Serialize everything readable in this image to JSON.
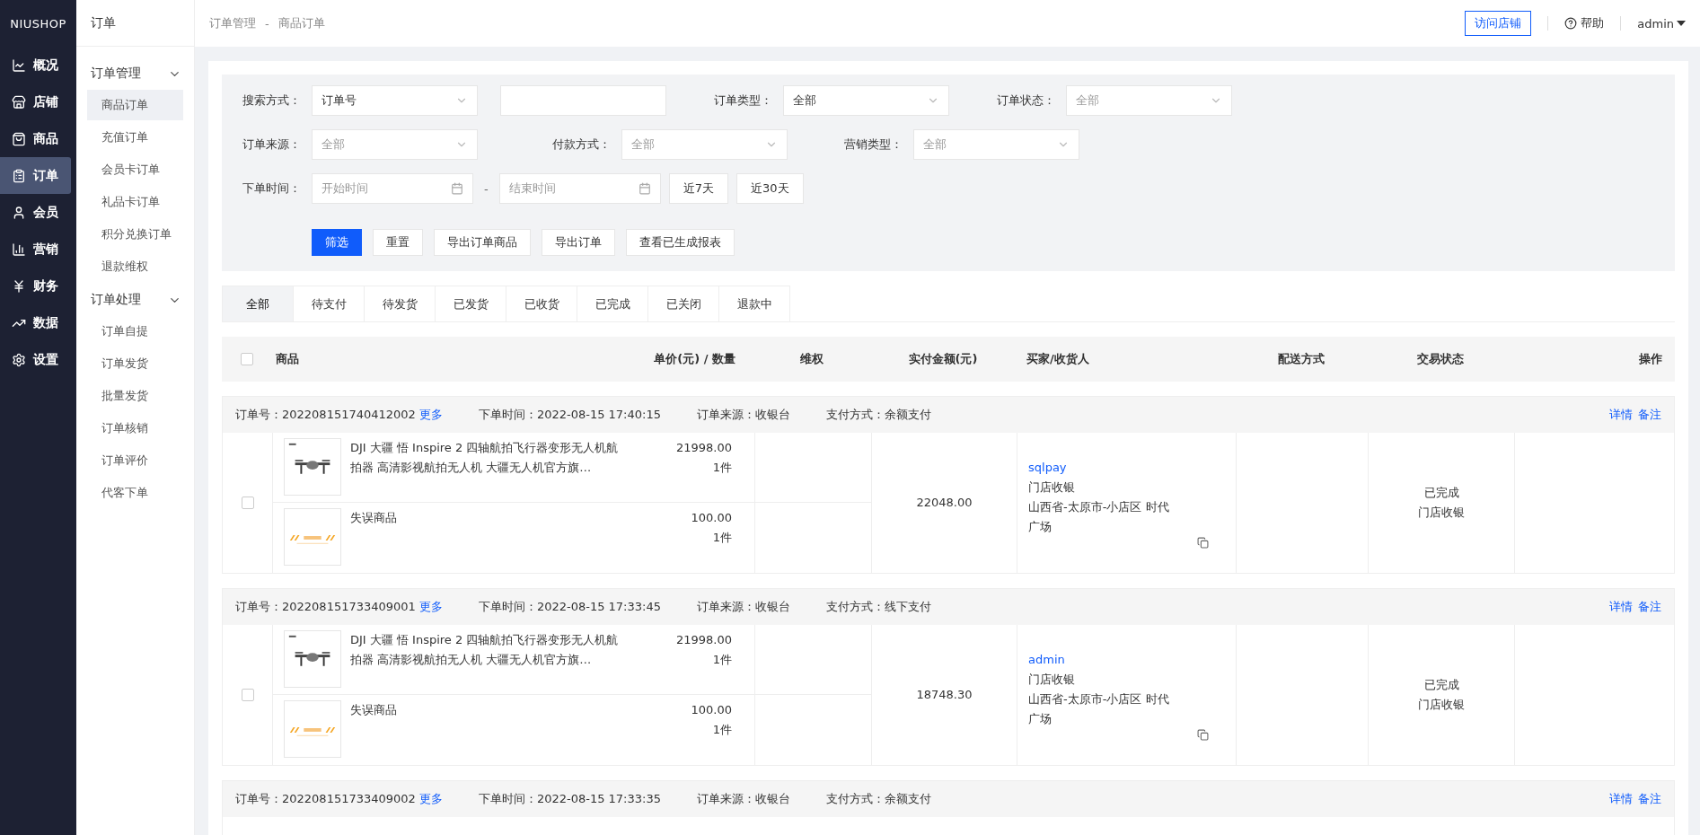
{
  "brand": "NIUSHOP",
  "nav": [
    {
      "label": "概况",
      "selected": false
    },
    {
      "label": "店铺",
      "selected": false
    },
    {
      "label": "商品",
      "selected": false
    },
    {
      "label": "订单",
      "selected": true
    },
    {
      "label": "会员",
      "selected": false
    },
    {
      "label": "营销",
      "selected": false
    },
    {
      "label": "财务",
      "selected": false
    },
    {
      "label": "数据",
      "selected": false
    },
    {
      "label": "设置",
      "selected": false
    }
  ],
  "subnav": {
    "title": "订单",
    "groups": [
      {
        "label": "订单管理",
        "expanded": true,
        "items": [
          {
            "label": "商品订单",
            "selected": true
          },
          {
            "label": "充值订单",
            "selected": false
          },
          {
            "label": "会员卡订单",
            "selected": false
          },
          {
            "label": "礼品卡订单",
            "selected": false
          },
          {
            "label": "积分兑换订单",
            "selected": false
          },
          {
            "label": "退款维权",
            "selected": false
          }
        ]
      },
      {
        "label": "订单处理",
        "expanded": true,
        "items": [
          {
            "label": "订单自提",
            "selected": false
          },
          {
            "label": "订单发货",
            "selected": false
          },
          {
            "label": "批量发货",
            "selected": false
          },
          {
            "label": "订单核销",
            "selected": false
          },
          {
            "label": "订单评价",
            "selected": false
          },
          {
            "label": "代客下单",
            "selected": false
          }
        ]
      }
    ]
  },
  "breadcrumb": {
    "parent": "订单管理",
    "separator": "-",
    "current": "商品订单"
  },
  "header": {
    "visit_store": "访问店铺",
    "help": "帮助",
    "user": "admin"
  },
  "filters": [
    [
      {
        "kind": "select",
        "label": "搜索方式：",
        "value": "订单号"
      },
      {
        "kind": "input"
      },
      {
        "kind": "select",
        "label": "订单类型：",
        "value": "全部"
      },
      {
        "kind": "select",
        "label": "订单状态：",
        "placeholder": "全部"
      }
    ],
    [
      {
        "kind": "select",
        "label": "订单来源：",
        "placeholder": "全部"
      },
      {
        "kind": "select",
        "label": "付款方式：",
        "placeholder": "全部"
      },
      {
        "kind": "select",
        "label": "营销类型：",
        "placeholder": "全部"
      }
    ],
    [
      {
        "kind": "date",
        "label": "下单时间：",
        "placeholder": "开始时间"
      },
      {
        "kind": "dash",
        "text": "-"
      },
      {
        "kind": "date",
        "placeholder": "结束时间"
      },
      {
        "kind": "button",
        "text": "近7天"
      },
      {
        "kind": "button",
        "text": "近30天"
      }
    ]
  ],
  "actions": [
    {
      "label": "筛选",
      "primary": true
    },
    {
      "label": "重置",
      "primary": false
    },
    {
      "label": "导出订单商品",
      "primary": false
    },
    {
      "label": "导出订单",
      "primary": false
    },
    {
      "label": "查看已生成报表",
      "primary": false
    }
  ],
  "tabs": [
    {
      "label": "全部",
      "selected": true
    },
    {
      "label": "待支付",
      "selected": false
    },
    {
      "label": "待发货",
      "selected": false
    },
    {
      "label": "已发货",
      "selected": false
    },
    {
      "label": "已收货",
      "selected": false
    },
    {
      "label": "已完成",
      "selected": false
    },
    {
      "label": "已关闭",
      "selected": false
    },
    {
      "label": "退款中",
      "selected": false
    }
  ],
  "columns": {
    "checked": false,
    "product": "商品",
    "price": "单价(元) / 数量",
    "rights": "维权",
    "paid": "实付金额(元)",
    "buyer": "买家/收货人",
    "delivery": "配送方式",
    "status": "交易状态",
    "operation": "操作"
  },
  "orders": [
    {
      "checked": false,
      "number_label": "订单号：",
      "number": "202208151740412002",
      "more": "更多",
      "time_label": "下单时间：",
      "time": "2022-08-15 17:40:15",
      "source_label": "订单来源：",
      "source": "收银台",
      "payment_label": "支付方式：",
      "payment": "余额支付",
      "actions": [
        "详情",
        "备注"
      ],
      "items": [
        {
          "name": "DJI 大疆 悟 Inspire 2 四轴航拍飞行器变形无人机航拍器 高清影视航拍无人机 大疆无人机官方旗…",
          "price": "21998.00",
          "quantity": "1件",
          "kind": "drone"
        },
        {
          "name": "失误商品",
          "price": "100.00",
          "quantity": "1件",
          "kind": "placeholder"
        }
      ],
      "paid": "22048.00",
      "buyer": "sqlpay",
      "delivery": "门店收银",
      "address": "山西省-太原市-小店区 时代广场",
      "status": "已完成",
      "status_detail": "门店收银"
    },
    {
      "checked": false,
      "number_label": "订单号：",
      "number": "202208151733409001",
      "more": "更多",
      "time_label": "下单时间：",
      "time": "2022-08-15 17:33:45",
      "source_label": "订单来源：",
      "source": "收银台",
      "payment_label": "支付方式：",
      "payment": "线下支付",
      "actions": [
        "详情",
        "备注"
      ],
      "items": [
        {
          "name": "DJI 大疆 悟 Inspire 2 四轴航拍飞行器变形无人机航拍器 高清影视航拍无人机 大疆无人机官方旗…",
          "price": "21998.00",
          "quantity": "1件",
          "kind": "drone"
        },
        {
          "name": "失误商品",
          "price": "100.00",
          "quantity": "1件",
          "kind": "placeholder"
        }
      ],
      "paid": "18748.30",
      "buyer": "admin",
      "delivery": "门店收银",
      "address": "山西省-太原市-小店区 时代广场",
      "status": "已完成",
      "status_detail": "门店收银"
    },
    {
      "number_label": "订单号：",
      "number": "202208151733409002",
      "more": "更多",
      "time_label": "下单时间：",
      "time": "2022-08-15 17:33:35",
      "source_label": "订单来源：",
      "source": "收银台",
      "payment_label": "支付方式：",
      "payment": "余额支付",
      "actions": [
        "详情",
        "备注"
      ]
    }
  ]
}
